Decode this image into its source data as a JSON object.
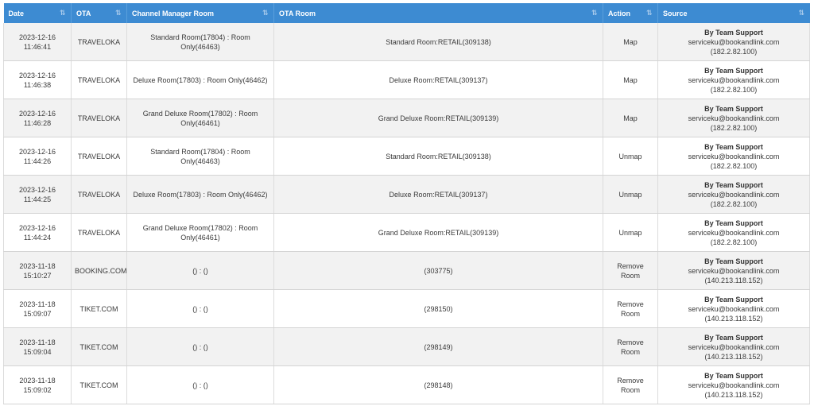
{
  "columns": [
    "Date",
    "OTA",
    "Channel Manager Room",
    "OTA Room",
    "Action",
    "Source"
  ],
  "rows": [
    {
      "date": "2023-12-16 11:46:41",
      "ota": "TRAVELOKA",
      "cm_room": "Standard Room(17804) : Room Only(46463)",
      "ota_room": "Standard Room:RETAIL(309138)",
      "action": "Map",
      "team": "By Team Support",
      "email": "serviceku@bookandlink.com",
      "ip": "(182.2.82.100)"
    },
    {
      "date": "2023-12-16 11:46:38",
      "ota": "TRAVELOKA",
      "cm_room": "Deluxe Room(17803) : Room Only(46462)",
      "ota_room": "Deluxe Room:RETAIL(309137)",
      "action": "Map",
      "team": "By Team Support",
      "email": "serviceku@bookandlink.com",
      "ip": "(182.2.82.100)"
    },
    {
      "date": "2023-12-16 11:46:28",
      "ota": "TRAVELOKA",
      "cm_room": "Grand Deluxe Room(17802) : Room Only(46461)",
      "ota_room": "Grand Deluxe Room:RETAIL(309139)",
      "action": "Map",
      "team": "By Team Support",
      "email": "serviceku@bookandlink.com",
      "ip": "(182.2.82.100)"
    },
    {
      "date": "2023-12-16 11:44:26",
      "ota": "TRAVELOKA",
      "cm_room": "Standard Room(17804) : Room Only(46463)",
      "ota_room": "Standard Room:RETAIL(309138)",
      "action": "Unmap",
      "team": "By Team Support",
      "email": "serviceku@bookandlink.com",
      "ip": "(182.2.82.100)"
    },
    {
      "date": "2023-12-16 11:44:25",
      "ota": "TRAVELOKA",
      "cm_room": "Deluxe Room(17803) : Room Only(46462)",
      "ota_room": "Deluxe Room:RETAIL(309137)",
      "action": "Unmap",
      "team": "By Team Support",
      "email": "serviceku@bookandlink.com",
      "ip": "(182.2.82.100)"
    },
    {
      "date": "2023-12-16 11:44:24",
      "ota": "TRAVELOKA",
      "cm_room": "Grand Deluxe Room(17802) : Room Only(46461)",
      "ota_room": "Grand Deluxe Room:RETAIL(309139)",
      "action": "Unmap",
      "team": "By Team Support",
      "email": "serviceku@bookandlink.com",
      "ip": "(182.2.82.100)"
    },
    {
      "date": "2023-11-18 15:10:27",
      "ota": "BOOKING.COM",
      "cm_room": "() : ()",
      "ota_room": "(303775)",
      "action": "Remove Room",
      "team": "By Team Support",
      "email": "serviceku@bookandlink.com",
      "ip": "(140.213.118.152)"
    },
    {
      "date": "2023-11-18 15:09:07",
      "ota": "TIKET.COM",
      "cm_room": "() : ()",
      "ota_room": "(298150)",
      "action": "Remove Room",
      "team": "By Team Support",
      "email": "serviceku@bookandlink.com",
      "ip": "(140.213.118.152)"
    },
    {
      "date": "2023-11-18 15:09:04",
      "ota": "TIKET.COM",
      "cm_room": "() : ()",
      "ota_room": "(298149)",
      "action": "Remove Room",
      "team": "By Team Support",
      "email": "serviceku@bookandlink.com",
      "ip": "(140.213.118.152)"
    },
    {
      "date": "2023-11-18 15:09:02",
      "ota": "TIKET.COM",
      "cm_room": "() : ()",
      "ota_room": "(298148)",
      "action": "Remove Room",
      "team": "By Team Support",
      "email": "serviceku@bookandlink.com",
      "ip": "(140.213.118.152)"
    }
  ],
  "icons": {
    "sort": "sort-arrows-icon"
  },
  "colors": {
    "header_bg": "#3d8bd2",
    "row_alt": "#f2f2f2"
  }
}
